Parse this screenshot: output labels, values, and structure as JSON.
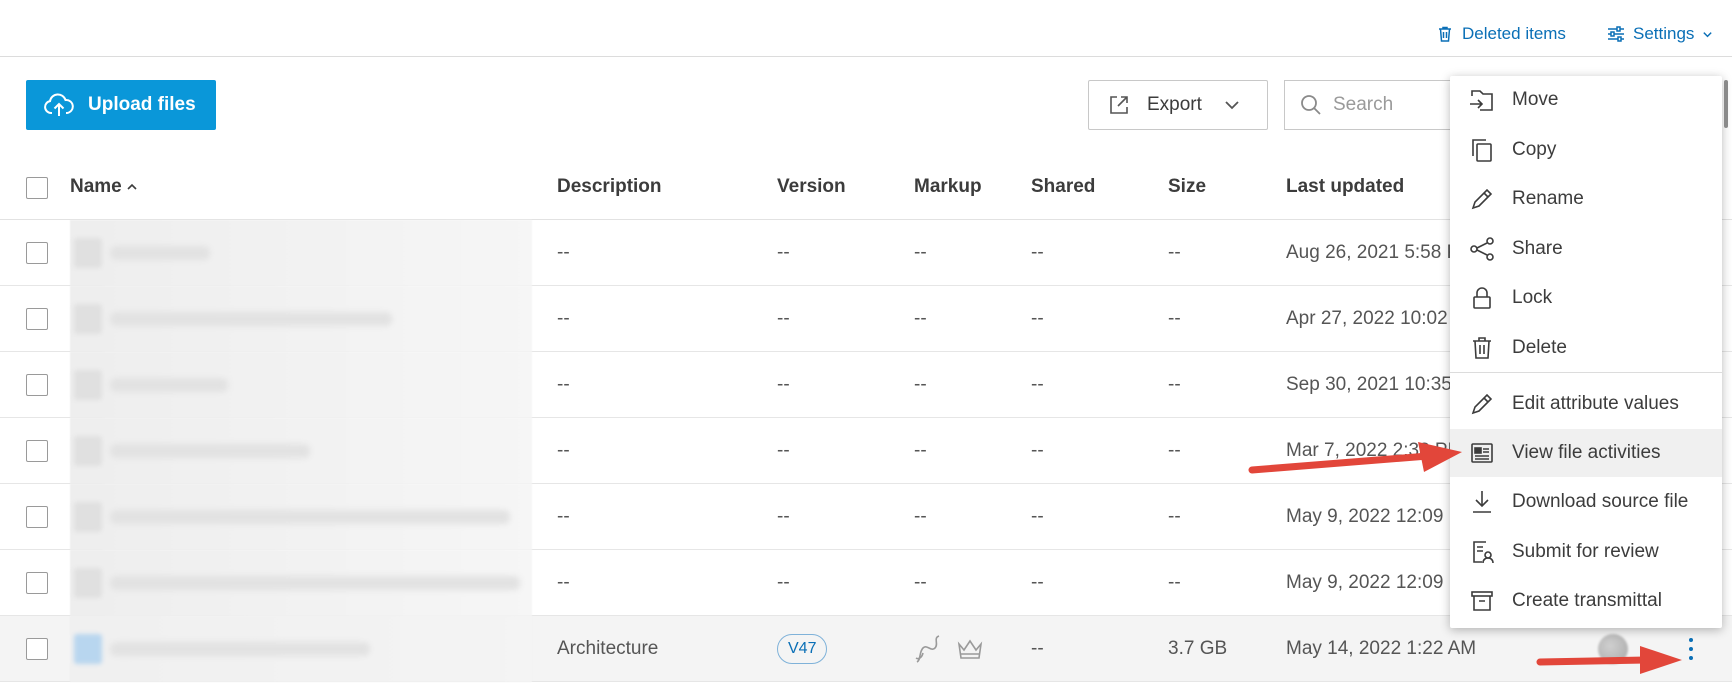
{
  "topbar": {
    "deleted_label": "Deleted items",
    "settings_label": "Settings"
  },
  "toolbar": {
    "upload_label": "Upload files",
    "export_label": "Export",
    "search_placeholder": "Search"
  },
  "table": {
    "columns": [
      "Name",
      "Description",
      "Version",
      "Markup",
      "Shared",
      "Size",
      "Last updated"
    ],
    "rows": [
      {
        "description": "--",
        "version": "--",
        "markup": "--",
        "shared": "--",
        "size": "--",
        "updated": "Aug 26, 2021 5:58 PM"
      },
      {
        "description": "--",
        "version": "--",
        "markup": "--",
        "shared": "--",
        "size": "--",
        "updated": "Apr 27, 2022 10:02 AM"
      },
      {
        "description": "--",
        "version": "--",
        "markup": "--",
        "shared": "--",
        "size": "--",
        "updated": "Sep 30, 2021 10:35 AM"
      },
      {
        "description": "--",
        "version": "--",
        "markup": "--",
        "shared": "--",
        "size": "--",
        "updated": "Mar 7, 2022 2:38 PM"
      },
      {
        "description": "--",
        "version": "--",
        "markup": "--",
        "shared": "--",
        "size": "--",
        "updated": "May 9, 2022 12:09 PM"
      },
      {
        "description": "--",
        "version": "--",
        "markup": "--",
        "shared": "--",
        "size": "--",
        "updated": "May 9, 2022 12:09 PM"
      },
      {
        "description": "Architecture",
        "version": "V47",
        "markup": "",
        "shared": "--",
        "size": "3.7 GB",
        "updated": "May 14, 2022 1:22 AM"
      }
    ]
  },
  "menu": {
    "items": [
      {
        "label": "Move",
        "icon": "move-icon"
      },
      {
        "label": "Copy",
        "icon": "copy-icon"
      },
      {
        "label": "Rename",
        "icon": "pencil-icon"
      },
      {
        "label": "Share",
        "icon": "share-icon"
      },
      {
        "label": "Lock",
        "icon": "lock-icon"
      },
      {
        "label": "Delete",
        "icon": "trash-icon"
      },
      {
        "label": "Edit attribute values",
        "icon": "pencil-icon"
      },
      {
        "label": "View file activities",
        "icon": "activity-icon"
      },
      {
        "label": "Download source file",
        "icon": "download-icon"
      },
      {
        "label": "Submit for review",
        "icon": "review-icon"
      },
      {
        "label": "Create transmittal",
        "icon": "transmittal-icon"
      }
    ]
  },
  "colors": {
    "accent": "#0a97d9",
    "link": "#0a6fb6",
    "annotation": "#e2463a"
  }
}
